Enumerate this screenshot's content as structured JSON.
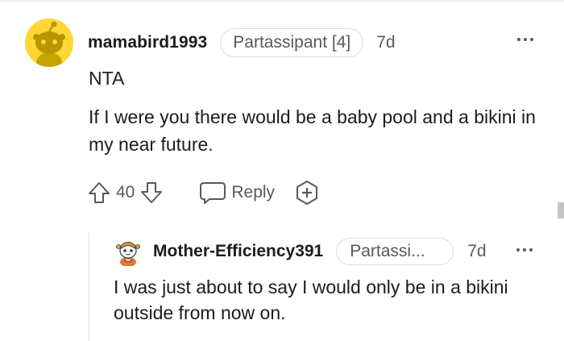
{
  "comment": {
    "username": "mamabird1993",
    "flair": "Partassipant [4]",
    "timestamp": "7d",
    "verdict": "NTA",
    "body": "If I were you there would be a baby pool and a bikini in my near future.",
    "score": "40",
    "reply_label": "Reply",
    "icons": {
      "avatar": "snoo-avatar-yellow",
      "upvote": "arrow-up-icon",
      "downvote": "arrow-down-icon",
      "reply": "speech-bubble-icon",
      "award": "award-plus-icon",
      "more": "ellipsis-icon"
    }
  },
  "reply": {
    "username": "Mother-Efficiency391",
    "flair": "Partassi...",
    "timestamp": "7d",
    "body": "I was just about to say I would only be in a bikini outside from now on.",
    "icons": {
      "avatar": "snoo-avatar-costume",
      "more": "ellipsis-icon"
    }
  },
  "colors": {
    "avatar_bg": "#ffd635",
    "meta_text": "#555a5e",
    "text": "#1c1c1c",
    "border": "#dadcde"
  }
}
